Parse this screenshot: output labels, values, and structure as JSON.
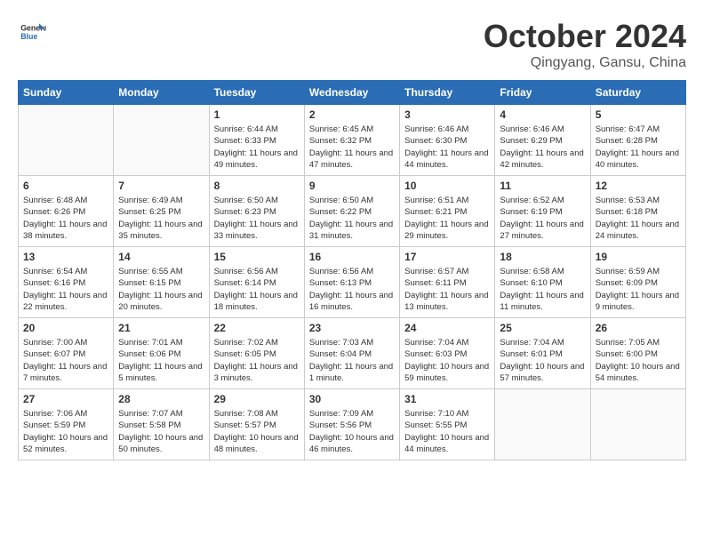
{
  "logo": {
    "general": "General",
    "blue": "Blue"
  },
  "title": "October 2024",
  "location": "Qingyang, Gansu, China",
  "weekdays": [
    "Sunday",
    "Monday",
    "Tuesday",
    "Wednesday",
    "Thursday",
    "Friday",
    "Saturday"
  ],
  "weeks": [
    [
      {
        "day": "",
        "sunrise": "",
        "sunset": "",
        "daylight": ""
      },
      {
        "day": "",
        "sunrise": "",
        "sunset": "",
        "daylight": ""
      },
      {
        "day": "1",
        "sunrise": "Sunrise: 6:44 AM",
        "sunset": "Sunset: 6:33 PM",
        "daylight": "Daylight: 11 hours and 49 minutes."
      },
      {
        "day": "2",
        "sunrise": "Sunrise: 6:45 AM",
        "sunset": "Sunset: 6:32 PM",
        "daylight": "Daylight: 11 hours and 47 minutes."
      },
      {
        "day": "3",
        "sunrise": "Sunrise: 6:46 AM",
        "sunset": "Sunset: 6:30 PM",
        "daylight": "Daylight: 11 hours and 44 minutes."
      },
      {
        "day": "4",
        "sunrise": "Sunrise: 6:46 AM",
        "sunset": "Sunset: 6:29 PM",
        "daylight": "Daylight: 11 hours and 42 minutes."
      },
      {
        "day": "5",
        "sunrise": "Sunrise: 6:47 AM",
        "sunset": "Sunset: 6:28 PM",
        "daylight": "Daylight: 11 hours and 40 minutes."
      }
    ],
    [
      {
        "day": "6",
        "sunrise": "Sunrise: 6:48 AM",
        "sunset": "Sunset: 6:26 PM",
        "daylight": "Daylight: 11 hours and 38 minutes."
      },
      {
        "day": "7",
        "sunrise": "Sunrise: 6:49 AM",
        "sunset": "Sunset: 6:25 PM",
        "daylight": "Daylight: 11 hours and 35 minutes."
      },
      {
        "day": "8",
        "sunrise": "Sunrise: 6:50 AM",
        "sunset": "Sunset: 6:23 PM",
        "daylight": "Daylight: 11 hours and 33 minutes."
      },
      {
        "day": "9",
        "sunrise": "Sunrise: 6:50 AM",
        "sunset": "Sunset: 6:22 PM",
        "daylight": "Daylight: 11 hours and 31 minutes."
      },
      {
        "day": "10",
        "sunrise": "Sunrise: 6:51 AM",
        "sunset": "Sunset: 6:21 PM",
        "daylight": "Daylight: 11 hours and 29 minutes."
      },
      {
        "day": "11",
        "sunrise": "Sunrise: 6:52 AM",
        "sunset": "Sunset: 6:19 PM",
        "daylight": "Daylight: 11 hours and 27 minutes."
      },
      {
        "day": "12",
        "sunrise": "Sunrise: 6:53 AM",
        "sunset": "Sunset: 6:18 PM",
        "daylight": "Daylight: 11 hours and 24 minutes."
      }
    ],
    [
      {
        "day": "13",
        "sunrise": "Sunrise: 6:54 AM",
        "sunset": "Sunset: 6:16 PM",
        "daylight": "Daylight: 11 hours and 22 minutes."
      },
      {
        "day": "14",
        "sunrise": "Sunrise: 6:55 AM",
        "sunset": "Sunset: 6:15 PM",
        "daylight": "Daylight: 11 hours and 20 minutes."
      },
      {
        "day": "15",
        "sunrise": "Sunrise: 6:56 AM",
        "sunset": "Sunset: 6:14 PM",
        "daylight": "Daylight: 11 hours and 18 minutes."
      },
      {
        "day": "16",
        "sunrise": "Sunrise: 6:56 AM",
        "sunset": "Sunset: 6:13 PM",
        "daylight": "Daylight: 11 hours and 16 minutes."
      },
      {
        "day": "17",
        "sunrise": "Sunrise: 6:57 AM",
        "sunset": "Sunset: 6:11 PM",
        "daylight": "Daylight: 11 hours and 13 minutes."
      },
      {
        "day": "18",
        "sunrise": "Sunrise: 6:58 AM",
        "sunset": "Sunset: 6:10 PM",
        "daylight": "Daylight: 11 hours and 11 minutes."
      },
      {
        "day": "19",
        "sunrise": "Sunrise: 6:59 AM",
        "sunset": "Sunset: 6:09 PM",
        "daylight": "Daylight: 11 hours and 9 minutes."
      }
    ],
    [
      {
        "day": "20",
        "sunrise": "Sunrise: 7:00 AM",
        "sunset": "Sunset: 6:07 PM",
        "daylight": "Daylight: 11 hours and 7 minutes."
      },
      {
        "day": "21",
        "sunrise": "Sunrise: 7:01 AM",
        "sunset": "Sunset: 6:06 PM",
        "daylight": "Daylight: 11 hours and 5 minutes."
      },
      {
        "day": "22",
        "sunrise": "Sunrise: 7:02 AM",
        "sunset": "Sunset: 6:05 PM",
        "daylight": "Daylight: 11 hours and 3 minutes."
      },
      {
        "day": "23",
        "sunrise": "Sunrise: 7:03 AM",
        "sunset": "Sunset: 6:04 PM",
        "daylight": "Daylight: 11 hours and 1 minute."
      },
      {
        "day": "24",
        "sunrise": "Sunrise: 7:04 AM",
        "sunset": "Sunset: 6:03 PM",
        "daylight": "Daylight: 10 hours and 59 minutes."
      },
      {
        "day": "25",
        "sunrise": "Sunrise: 7:04 AM",
        "sunset": "Sunset: 6:01 PM",
        "daylight": "Daylight: 10 hours and 57 minutes."
      },
      {
        "day": "26",
        "sunrise": "Sunrise: 7:05 AM",
        "sunset": "Sunset: 6:00 PM",
        "daylight": "Daylight: 10 hours and 54 minutes."
      }
    ],
    [
      {
        "day": "27",
        "sunrise": "Sunrise: 7:06 AM",
        "sunset": "Sunset: 5:59 PM",
        "daylight": "Daylight: 10 hours and 52 minutes."
      },
      {
        "day": "28",
        "sunrise": "Sunrise: 7:07 AM",
        "sunset": "Sunset: 5:58 PM",
        "daylight": "Daylight: 10 hours and 50 minutes."
      },
      {
        "day": "29",
        "sunrise": "Sunrise: 7:08 AM",
        "sunset": "Sunset: 5:57 PM",
        "daylight": "Daylight: 10 hours and 48 minutes."
      },
      {
        "day": "30",
        "sunrise": "Sunrise: 7:09 AM",
        "sunset": "Sunset: 5:56 PM",
        "daylight": "Daylight: 10 hours and 46 minutes."
      },
      {
        "day": "31",
        "sunrise": "Sunrise: 7:10 AM",
        "sunset": "Sunset: 5:55 PM",
        "daylight": "Daylight: 10 hours and 44 minutes."
      },
      {
        "day": "",
        "sunrise": "",
        "sunset": "",
        "daylight": ""
      },
      {
        "day": "",
        "sunrise": "",
        "sunset": "",
        "daylight": ""
      }
    ]
  ]
}
